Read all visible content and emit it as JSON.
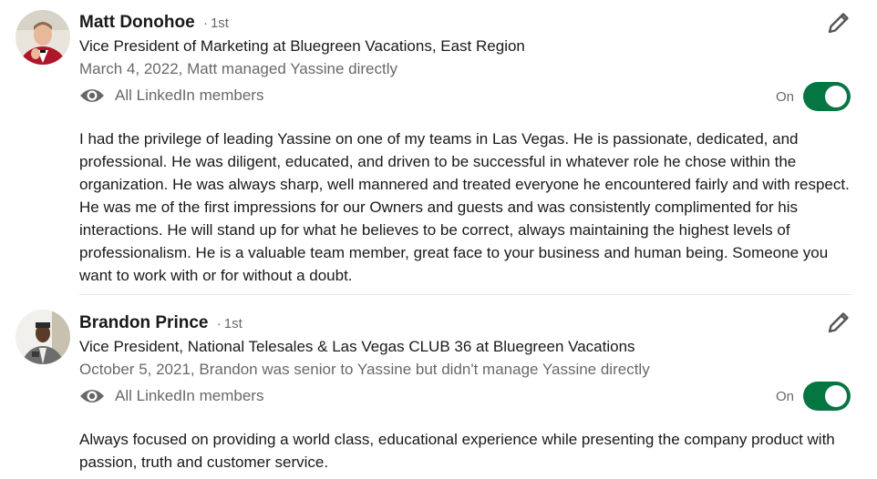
{
  "recommendations": [
    {
      "name": "Matt Donohoe",
      "degree_separator": "·",
      "degree": "1st",
      "title": "Vice President of Marketing at Bluegreen Vacations, East Region",
      "meta": "March 4, 2022, Matt managed Yassine directly",
      "visibility": "All LinkedIn members",
      "visibility_icon": "eye-icon",
      "toggle_label": "On",
      "toggle_state": true,
      "text": "I had the privilege of leading Yassine on one of my teams in Las Vegas. He is passionate, dedicated, and professional. He was diligent, educated, and driven to be successful in whatever role he chose within the organization. He was always sharp, well mannered and treated everyone he encountered fairly and with respect. He was me of the first impressions for our Owners and guests and was consistently complimented for his interactions. He will stand up for what he believes to be correct, always maintaining the highest levels of professionalism. He is a valuable team member, great face to your business and human being. Someone you want to work with or for without a doubt."
    },
    {
      "name": "Brandon Prince",
      "degree_separator": "·",
      "degree": "1st",
      "title": "Vice President, National Telesales & Las Vegas CLUB 36 at Bluegreen Vacations",
      "meta": "October 5, 2021, Brandon was senior to Yassine but didn't manage Yassine directly",
      "visibility": "All LinkedIn members",
      "visibility_icon": "eye-icon",
      "toggle_label": "On",
      "toggle_state": true,
      "text": "Always focused on providing a world class, educational experience while presenting the company product with passion, truth and customer service."
    }
  ],
  "colors": {
    "toggle_on": "#057642",
    "text_primary": "#1f1f1f",
    "text_secondary": "#666666",
    "divider": "#e8e8e8"
  }
}
